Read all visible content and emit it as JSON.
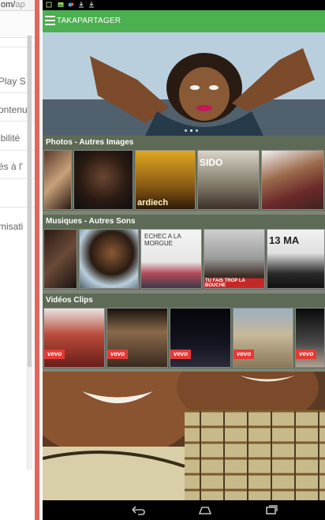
{
  "background_page": {
    "url_text": "om/",
    "url_rest": "ap",
    "items": [
      "Play S",
      "ontenu",
      "ibilité",
      "és à l'",
      "l",
      "misati"
    ]
  },
  "statusbar": {
    "icons": [
      "notification-icon",
      "image-icon",
      "game-icon",
      "download-icon",
      "download-icon"
    ]
  },
  "appbar": {
    "title": "TAKAPARTAGER"
  },
  "banner": {
    "dots": 3,
    "active_dot": 1
  },
  "sections": [
    {
      "title": "Photos - Autres Images",
      "thumbs": [
        {
          "label": ""
        },
        {
          "label": ""
        },
        {
          "label": "ardiech"
        },
        {
          "label": "SIDO"
        },
        {
          "label": ""
        }
      ]
    },
    {
      "title": "Musiques - Autres Sons",
      "thumbs": [
        {
          "label": ""
        },
        {
          "label": ""
        },
        {
          "label": "ECHEC A LA MORGUE"
        },
        {
          "label": "TU FAIS TROP LA BOUCHE"
        },
        {
          "label": "13 MA"
        }
      ]
    },
    {
      "title": "Vidéos Clips",
      "thumbs": [
        {
          "badge": "vevo"
        },
        {
          "badge": "vevo"
        },
        {
          "badge": "vevo"
        },
        {
          "badge": "vevo"
        },
        {
          "badge": "vevo"
        }
      ]
    }
  ],
  "navbar": {
    "buttons": [
      "back-icon",
      "home-icon",
      "recents-icon"
    ]
  },
  "colors": {
    "appbar": "#4caf50",
    "section_bg": "#5d6b56",
    "vevo": "#e53935"
  }
}
